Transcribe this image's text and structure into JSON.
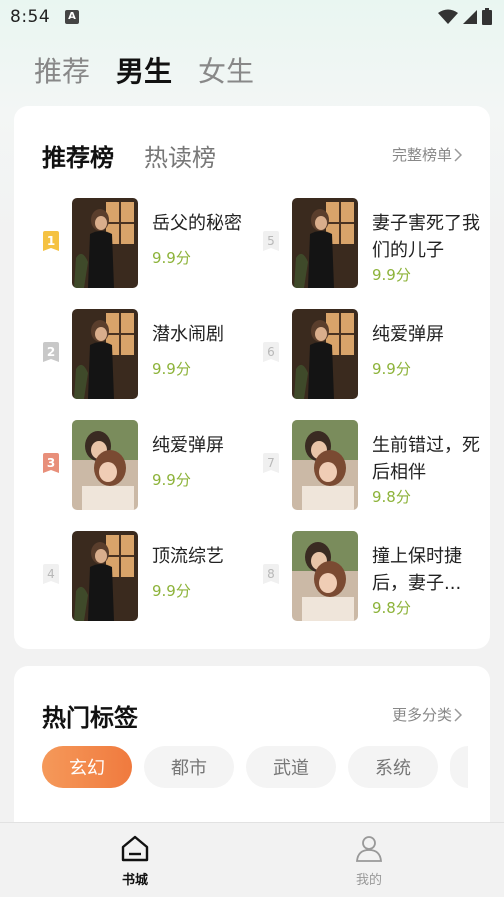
{
  "status_bar": {
    "time": "8:54",
    "notification_icon": "A"
  },
  "top_tabs": [
    {
      "label": "推荐",
      "active": false
    },
    {
      "label": "男生",
      "active": true
    },
    {
      "label": "女生",
      "active": false
    }
  ],
  "rank_card": {
    "tabs": [
      {
        "label": "推荐榜",
        "active": true
      },
      {
        "label": "热读榜",
        "active": false
      }
    ],
    "more_label": "完整榜单",
    "items": [
      {
        "rank": "1",
        "title": "岳父的秘密",
        "score": "9.9分",
        "cover": "woman"
      },
      {
        "rank": "2",
        "title": "潜水闹剧",
        "score": "9.9分",
        "cover": "woman"
      },
      {
        "rank": "3",
        "title": "纯爱弹屏",
        "score": "9.9分",
        "cover": "couple"
      },
      {
        "rank": "4",
        "title": "顶流综艺",
        "score": "9.9分",
        "cover": "woman"
      },
      {
        "rank": "5",
        "title": "妻子害死了我们的儿子",
        "score": "9.9分",
        "cover": "woman"
      },
      {
        "rank": "6",
        "title": "纯爱弹屏",
        "score": "9.9分",
        "cover": "woman"
      },
      {
        "rank": "7",
        "title": "生前错过，死后相伴",
        "score": "9.8分",
        "cover": "couple"
      },
      {
        "rank": "8",
        "title": "撞上保时捷后，妻子...",
        "score": "9.8分",
        "cover": "couple"
      }
    ]
  },
  "tag_card": {
    "title": "热门标签",
    "more_label": "更多分类",
    "tags": [
      {
        "label": "玄幻",
        "active": true
      },
      {
        "label": "都市",
        "active": false
      },
      {
        "label": "武道",
        "active": false
      },
      {
        "label": "系统",
        "active": false
      }
    ]
  },
  "bottom_nav": [
    {
      "label": "书城",
      "icon": "home-icon",
      "active": true
    },
    {
      "label": "我的",
      "icon": "person-icon",
      "active": false
    }
  ],
  "colors": {
    "accent": "#f07a3e",
    "score": "#8db33a",
    "rank1": "#f5c242",
    "rank2": "#c8c8c8",
    "rank3": "#e88f7a"
  }
}
